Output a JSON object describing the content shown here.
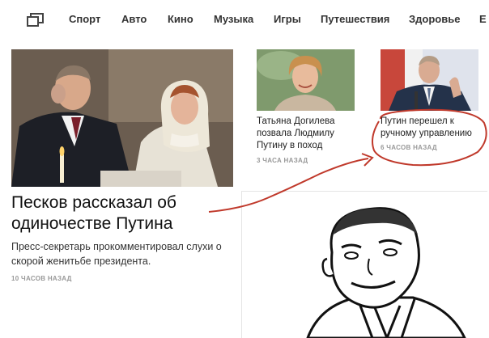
{
  "nav": {
    "items": [
      "Спорт",
      "Авто",
      "Кино",
      "Музыка",
      "Игры",
      "Путешествия",
      "Здоровье",
      "Е"
    ]
  },
  "main_story": {
    "headline": "Песков рассказал об одиночестве Путина",
    "lead": "Пресс-секретарь прокомментировал слухи о скорой женитьбе президента.",
    "time": "10 ЧАСОВ НАЗАД"
  },
  "side_stories": [
    {
      "title": "Татьяна Догилева позвала Людмилу Путину в поход",
      "time": "3 ЧАСА НАЗАД"
    },
    {
      "title": "Путин перешел к ручному управлению",
      "time": "6 ЧАСОВ НАЗАД"
    }
  ],
  "colors": {
    "annotation": "#c0392b"
  }
}
